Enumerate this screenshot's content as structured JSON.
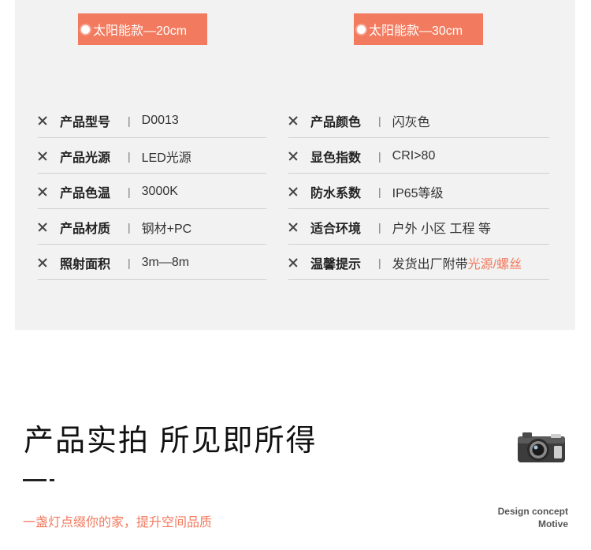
{
  "tags": [
    "太阳能款—20cm",
    "太阳能款—30cm"
  ],
  "specs_left": [
    {
      "label": "产品型号",
      "value": "D0013"
    },
    {
      "label": "产品光源",
      "value": "LED光源"
    },
    {
      "label": "产品色温",
      "value": "3000K"
    },
    {
      "label": "产品材质",
      "value": "钢材+PC"
    },
    {
      "label": "照射面积",
      "value": "3m—8m"
    }
  ],
  "specs_right": [
    {
      "label": "产品颜色",
      "value": "闪灰色"
    },
    {
      "label": "显色指数",
      "value": "CRI>80"
    },
    {
      "label": "防水系数",
      "value": "IP65等级"
    },
    {
      "label": "适合环境",
      "value": "户外 小区 工程 等"
    },
    {
      "label": "温馨提示",
      "value": "发货出厂附带",
      "highlight": "光源/螺丝"
    }
  ],
  "separator": "|",
  "section": {
    "title": "产品实拍 所见即所得",
    "subtitle": "一盏灯点缀你的家，提升空间品质",
    "design_line1": "Design concept",
    "design_line2": "Motive"
  },
  "icons": {
    "remove": "x-icon",
    "camera": "camera-icon",
    "tag_dot": "dot-icon"
  },
  "colors": {
    "accent": "#f27a5e",
    "panel": "#f2f2f2"
  }
}
